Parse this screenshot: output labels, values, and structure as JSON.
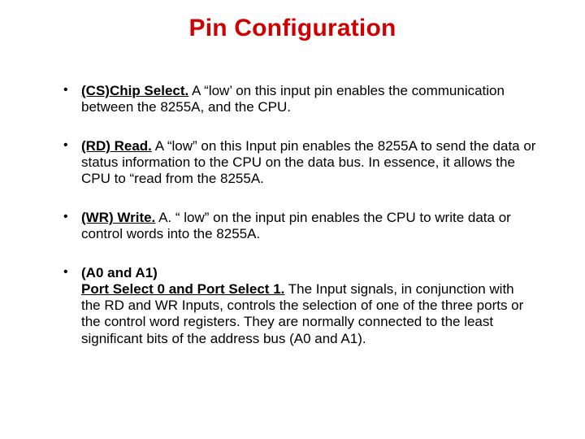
{
  "title": "Pin Configuration",
  "items": [
    {
      "lead": "(CS)Chip Select.",
      "body": " A “low’ on this input pin enables the communication between the 8255A, and the CPU."
    },
    {
      "lead": "(RD) Read.",
      "body": " A “low” on this Input pin enables the 8255A to send the data or status information to the CPU on the data bus. In essence, it allows the CPU to “read from the 8255A."
    },
    {
      "lead": "(WR) Write.",
      "body": " A. “ low” on the input pin enables the CPU to write data or control words into the 8255A."
    },
    {
      "lead": "(A0 and A1)",
      "sub_lead": "Port Select 0 and Port Select 1.",
      "body": " The Input signals, in conjunction with the RD and WR Inputs, controls the selection of one of the three ports or the control word registers. They are normally connected to the least significant bits of the address bus (A0 and A1)."
    }
  ]
}
